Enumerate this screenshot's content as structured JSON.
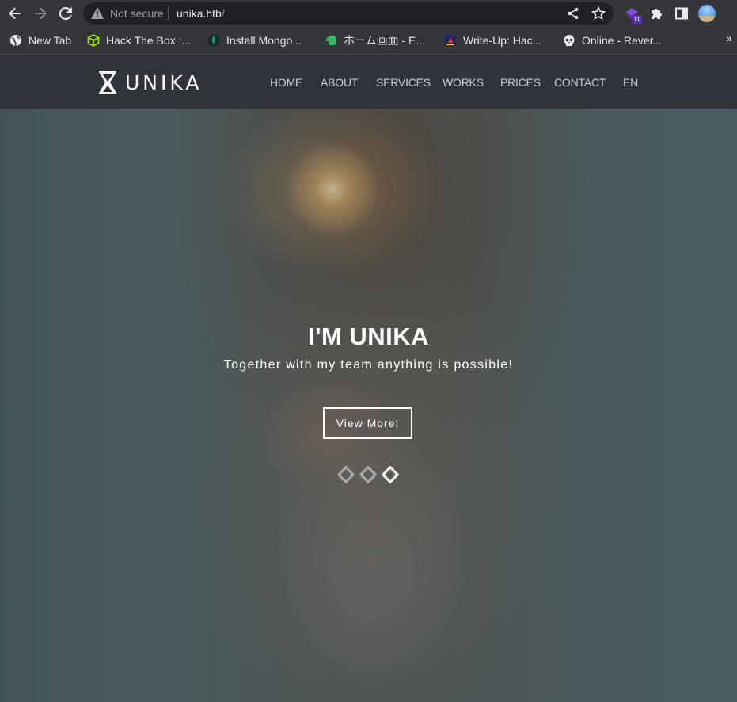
{
  "browser": {
    "security_label": "Not secure",
    "url_host": "unika.htb",
    "url_path": "/",
    "extension_badge": "11",
    "bookmarks": [
      {
        "label": "New Tab",
        "icon": "globe-icon"
      },
      {
        "label": "Hack The Box :...",
        "icon": "htb-cube-icon"
      },
      {
        "label": "Install Mongo...",
        "icon": "mongodb-leaf-icon"
      },
      {
        "label": "ホーム画面 - E...",
        "icon": "evernote-icon"
      },
      {
        "label": "Write-Up: Hac...",
        "icon": "writeup-icon"
      },
      {
        "label": "Online - Rever...",
        "icon": "skull-icon"
      }
    ],
    "more_bookmarks": "»"
  },
  "site": {
    "logo_text": "UNIKA",
    "menu": [
      "HOME",
      "ABOUT",
      "SERVICES",
      "WORKS",
      "PRICES",
      "CONTACT",
      "EN"
    ],
    "hero": {
      "title": "I'M UNIKA",
      "subtitle": "Together with my team anything is possible!",
      "button_label": "View More!",
      "slides_total": 3,
      "active_slide": 3
    }
  },
  "colors": {
    "chrome_bg": "#35363a",
    "nav_bg": "#31333b",
    "menu_text": "#c9ccd3"
  }
}
